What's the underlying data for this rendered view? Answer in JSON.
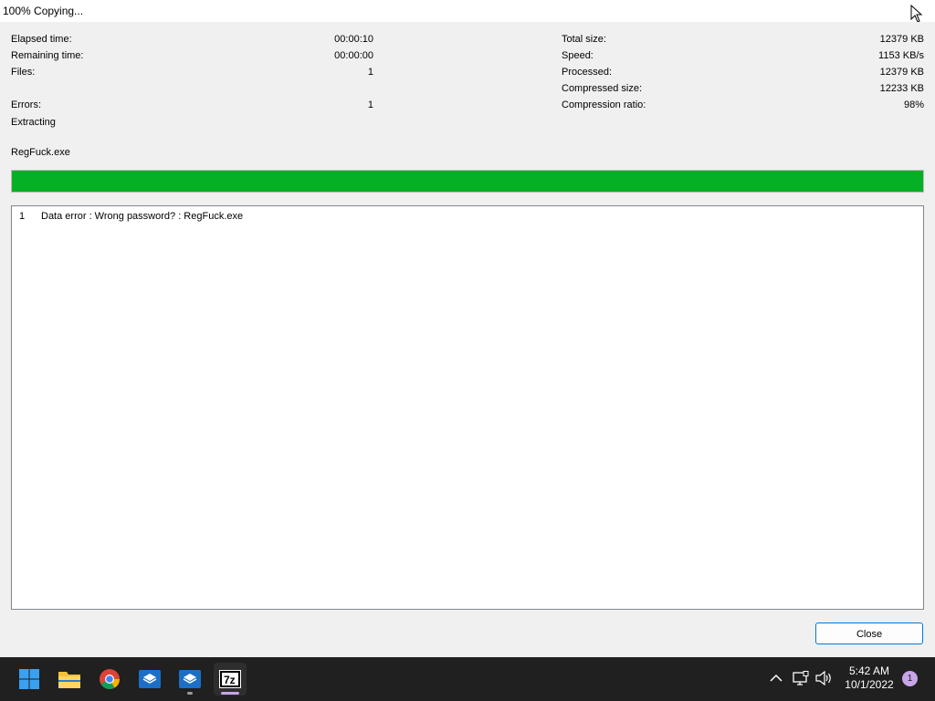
{
  "window": {
    "title": "100% Copying..."
  },
  "stats_left": [
    {
      "label": "Elapsed time:",
      "value": "00:00:10"
    },
    {
      "label": "Remaining time:",
      "value": "00:00:00"
    },
    {
      "label": "Files:",
      "value": "1"
    },
    {
      "label": "Errors:",
      "value": "1"
    }
  ],
  "stats_right": [
    {
      "label": "Total size:",
      "value": "12379 KB"
    },
    {
      "label": "Speed:",
      "value": "1153 KB/s"
    },
    {
      "label": "Processed:",
      "value": "12379 KB"
    },
    {
      "label": "Compressed size:",
      "value": "12233 KB"
    },
    {
      "label": "Compression ratio:",
      "value": "98%"
    }
  ],
  "status": {
    "operation": "Extracting",
    "current_file": "RegFuck.exe"
  },
  "progress": {
    "percent": 100,
    "color": "#06b025"
  },
  "errors": [
    {
      "num": "1",
      "message": "Data error : Wrong password? : RegFuck.exe"
    }
  ],
  "buttons": {
    "close_label": "Close"
  },
  "taskbar": {
    "icons": [
      "windows-start-icon",
      "file-explorer-icon",
      "chrome-icon",
      "package-installer-icon",
      "package-installer-icon-2",
      "7zip-icon"
    ],
    "clock_time": "5:42 AM",
    "clock_date": "10/1/2022",
    "notification_count": "1"
  }
}
